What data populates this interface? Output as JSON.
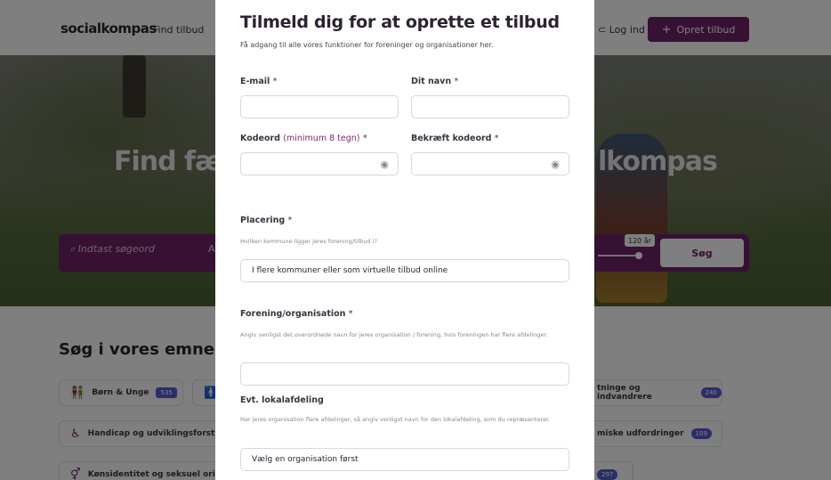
{
  "background": {
    "logo": "socialkompas",
    "nav": {
      "find_label": "Find tilbud",
      "login_label": "Log ind",
      "create_label": "Opret tilbud"
    },
    "hero": {
      "title_left": "Find fælle",
      "title_right": "lkompas"
    },
    "search": {
      "placeholder": "Indtast søgeord",
      "field_a": "A",
      "age_badge": "120 år",
      "button_label": "Søg"
    },
    "topics": {
      "title": "Søg i vores emner",
      "items": [
        {
          "label": "Børn & Unge",
          "count": "535"
        },
        {
          "label": "Handicap og udviklingsforsty"
        },
        {
          "label": "Kønsidentitet og seksuel orie"
        }
      ],
      "right_items": [
        {
          "label": "tninge og indvandrere",
          "count": "240"
        },
        {
          "label": "miske udfordringer",
          "count": "109"
        },
        {
          "count": "297"
        }
      ]
    }
  },
  "modal": {
    "title": "Tilmeld dig for at oprette et tilbud",
    "subtitle": "Få adgang til alle vores funktioner for foreninger og organisationer her.",
    "email": {
      "label": "E-mail",
      "required": "*"
    },
    "name": {
      "label": "Dit navn",
      "required": "*"
    },
    "password": {
      "label": "Kodeord",
      "hint": "(minimum 8 tegn)",
      "required": "*"
    },
    "confirm": {
      "label": "Bekræft kodeord",
      "required": "*"
    },
    "location": {
      "label": "Placering",
      "required": "*",
      "help": "Hvilken kommune ligger jeres forening/tilbud i?",
      "value": "I flere kommuner eller som virtuelle tilbud online"
    },
    "organisation": {
      "label": "Forening/organisation",
      "required": "*",
      "help_pre": "Angiv venligst det ",
      "help_em": "overordnede navn",
      "help_post": " for jeres organisation / forening, hvis foreningen har flere afdelinger."
    },
    "local": {
      "label": "Evt. lokalafdeling",
      "help": "Har jeres organisation flere afdelinger, så angiv venligst navn for den lokalafdeling, som du repræsenterer.",
      "value": "Vælg en organisation først"
    }
  }
}
